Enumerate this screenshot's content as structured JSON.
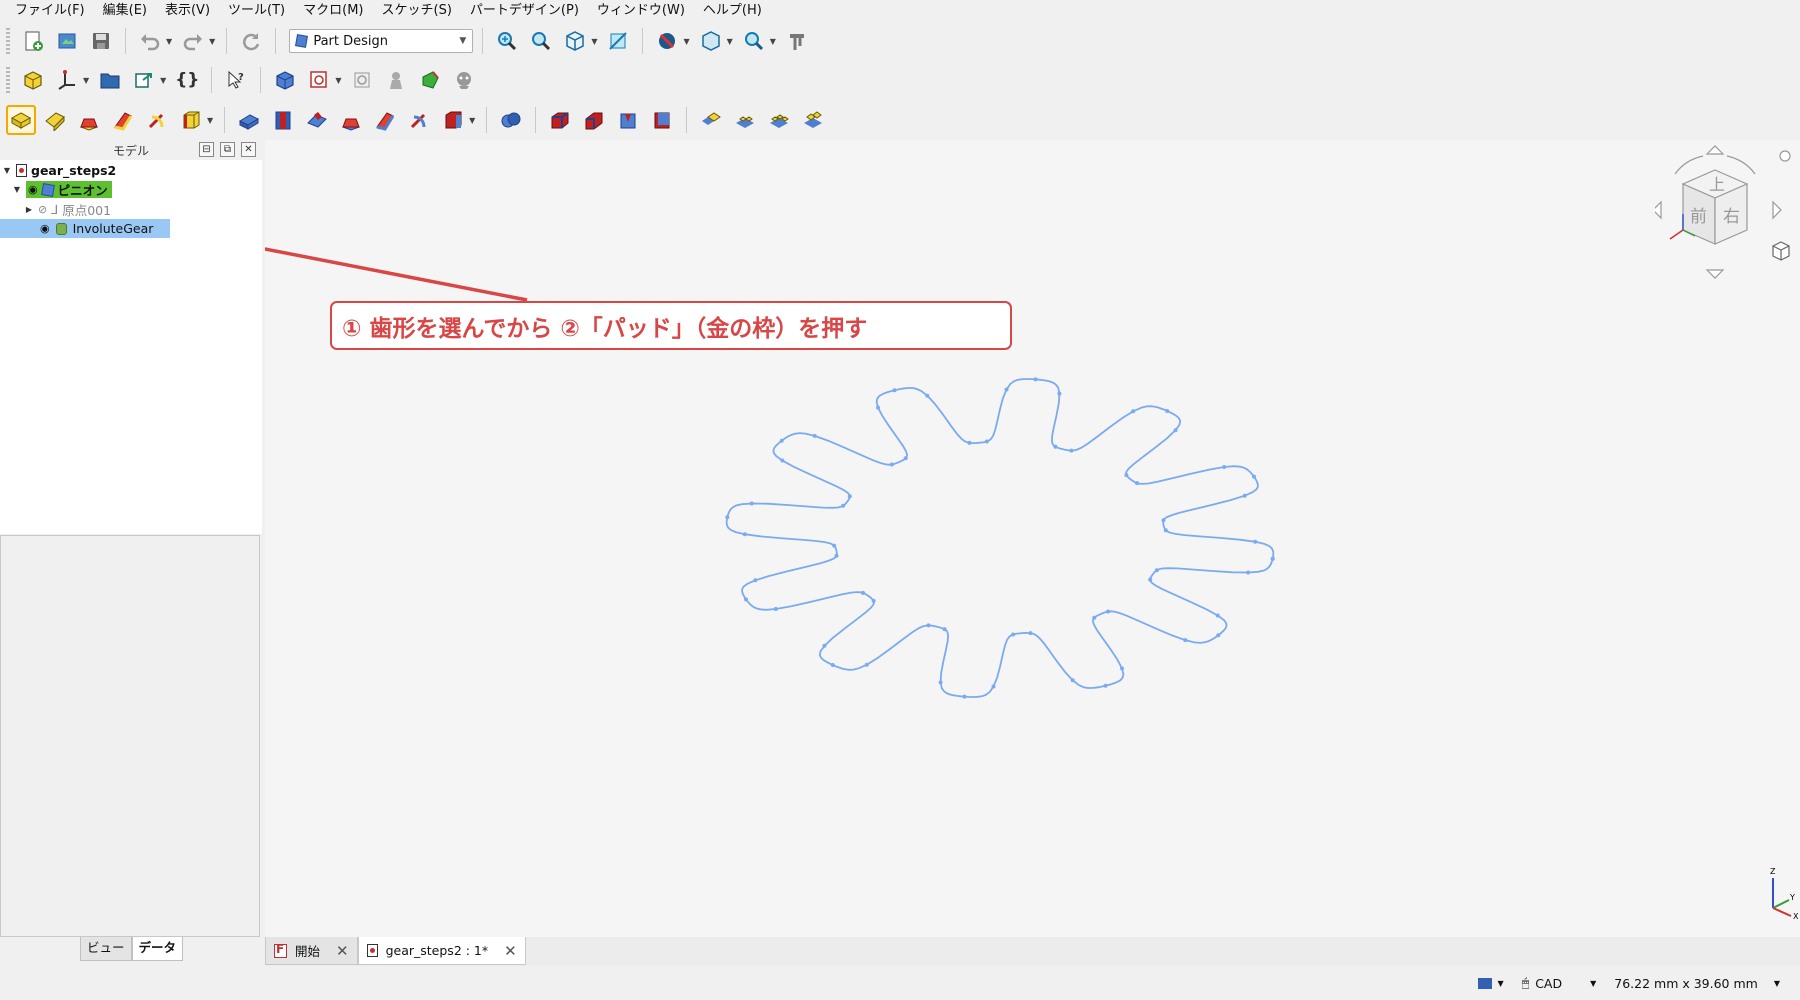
{
  "menu": [
    "ファイル(F)",
    "編集(E)",
    "表示(V)",
    "ツール(T)",
    "マクロ(M)",
    "スケッチ(S)",
    "パートデザイン(P)",
    "ウィンドウ(W)",
    "ヘルプ(H)"
  ],
  "workbench": {
    "selected": "Part Design"
  },
  "model_panel": {
    "title": "モデル",
    "tree": {
      "document": "gear_steps2",
      "body": "ピニオン",
      "origin": "原点001",
      "feature": "InvoluteGear"
    }
  },
  "bottom_tabs": [
    "ビュー",
    "データ"
  ],
  "annotation": "① 歯形を選んでから ②「パッド」（金の枠）を押す",
  "navcube": {
    "top": "上",
    "front": "前",
    "right": "右"
  },
  "axis": {
    "x": "X",
    "y": "Y",
    "z": "Z"
  },
  "doc_tabs": [
    {
      "label": "開始"
    },
    {
      "label": "gear_steps2 : 1*"
    }
  ],
  "status": {
    "nav_style": "CAD",
    "dimensions": "76.22 mm x 39.60 mm"
  },
  "colors": {
    "accent_gold": "#f5a800",
    "annotation_red": "#d84646",
    "selection_blue": "#99c8f5",
    "body_green": "#5cc030",
    "gear_line": "#7aaaf0"
  }
}
